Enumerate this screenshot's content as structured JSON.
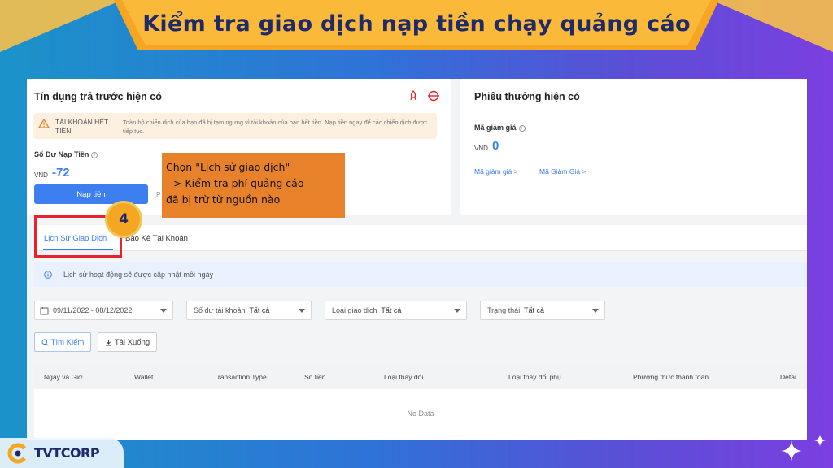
{
  "banner": {
    "title": "Kiểm tra giao dịch nạp tiền chạy quảng cáo"
  },
  "left_card": {
    "title": "Tín dụng trả trước hiện có",
    "warning_head": "TÀI KHOẢN HẾT TIỀN",
    "warning_text": "Toàn bộ chiến dịch của bạn đã bị tạm ngưng vì tài khoản của bạn hết tiền. Nạp tiền ngay để các chiến dịch được tiếp tục.",
    "balance_label": "Số Dư Nạp Tiền",
    "currency": "VND",
    "balance": "-72",
    "topup_button": "Nạp tiền",
    "hidden_link": "P"
  },
  "right_card": {
    "title": "Phiếu thưởng hiện có",
    "voucher_label": "Mã giảm giá",
    "currency": "VND",
    "voucher_value": "0",
    "link1": "Mã giảm giá >",
    "link2": "Mã Giảm Giá >"
  },
  "tabs": {
    "history": "Lịch Sử Giao Dịch",
    "statement": "Báo Kê Tài Khoản"
  },
  "info_bar": {
    "text": "Lịch sử hoạt động sẽ được cập nhật mỗi ngày"
  },
  "filters": {
    "date_range": "09/11/2022 - 08/12/2022",
    "balance": "Số dư tài khoản",
    "balance_value": "Tất cả",
    "type": "Loại giao dịch",
    "type_value": "Tất cả",
    "status": "Trạng thái",
    "status_value": "Tất cả"
  },
  "actions": {
    "search": "Tìm Kiếm",
    "download": "Tải Xuống"
  },
  "table": {
    "headers": [
      "Ngày và Giờ",
      "Wallet",
      "Transaction Type",
      "Số tiền",
      "Loại thay đổi",
      "Loại thay đổi phụ",
      "Phương thức thanh toán",
      "Detai"
    ],
    "empty": "No Data"
  },
  "callout": {
    "line1": "Chọn \"Lịch sử giao dịch\"",
    "line2": "--> Kiểm tra phí quảng cáo",
    "line3": "đã bị trừ từ nguồn nào"
  },
  "step_badge": "4",
  "logo": {
    "text": "TVTCORP"
  },
  "colors": {
    "accent": "#3d7ef0",
    "banner": "#f5a623",
    "callout": "#e8822a",
    "highlight": "#e8222a"
  }
}
